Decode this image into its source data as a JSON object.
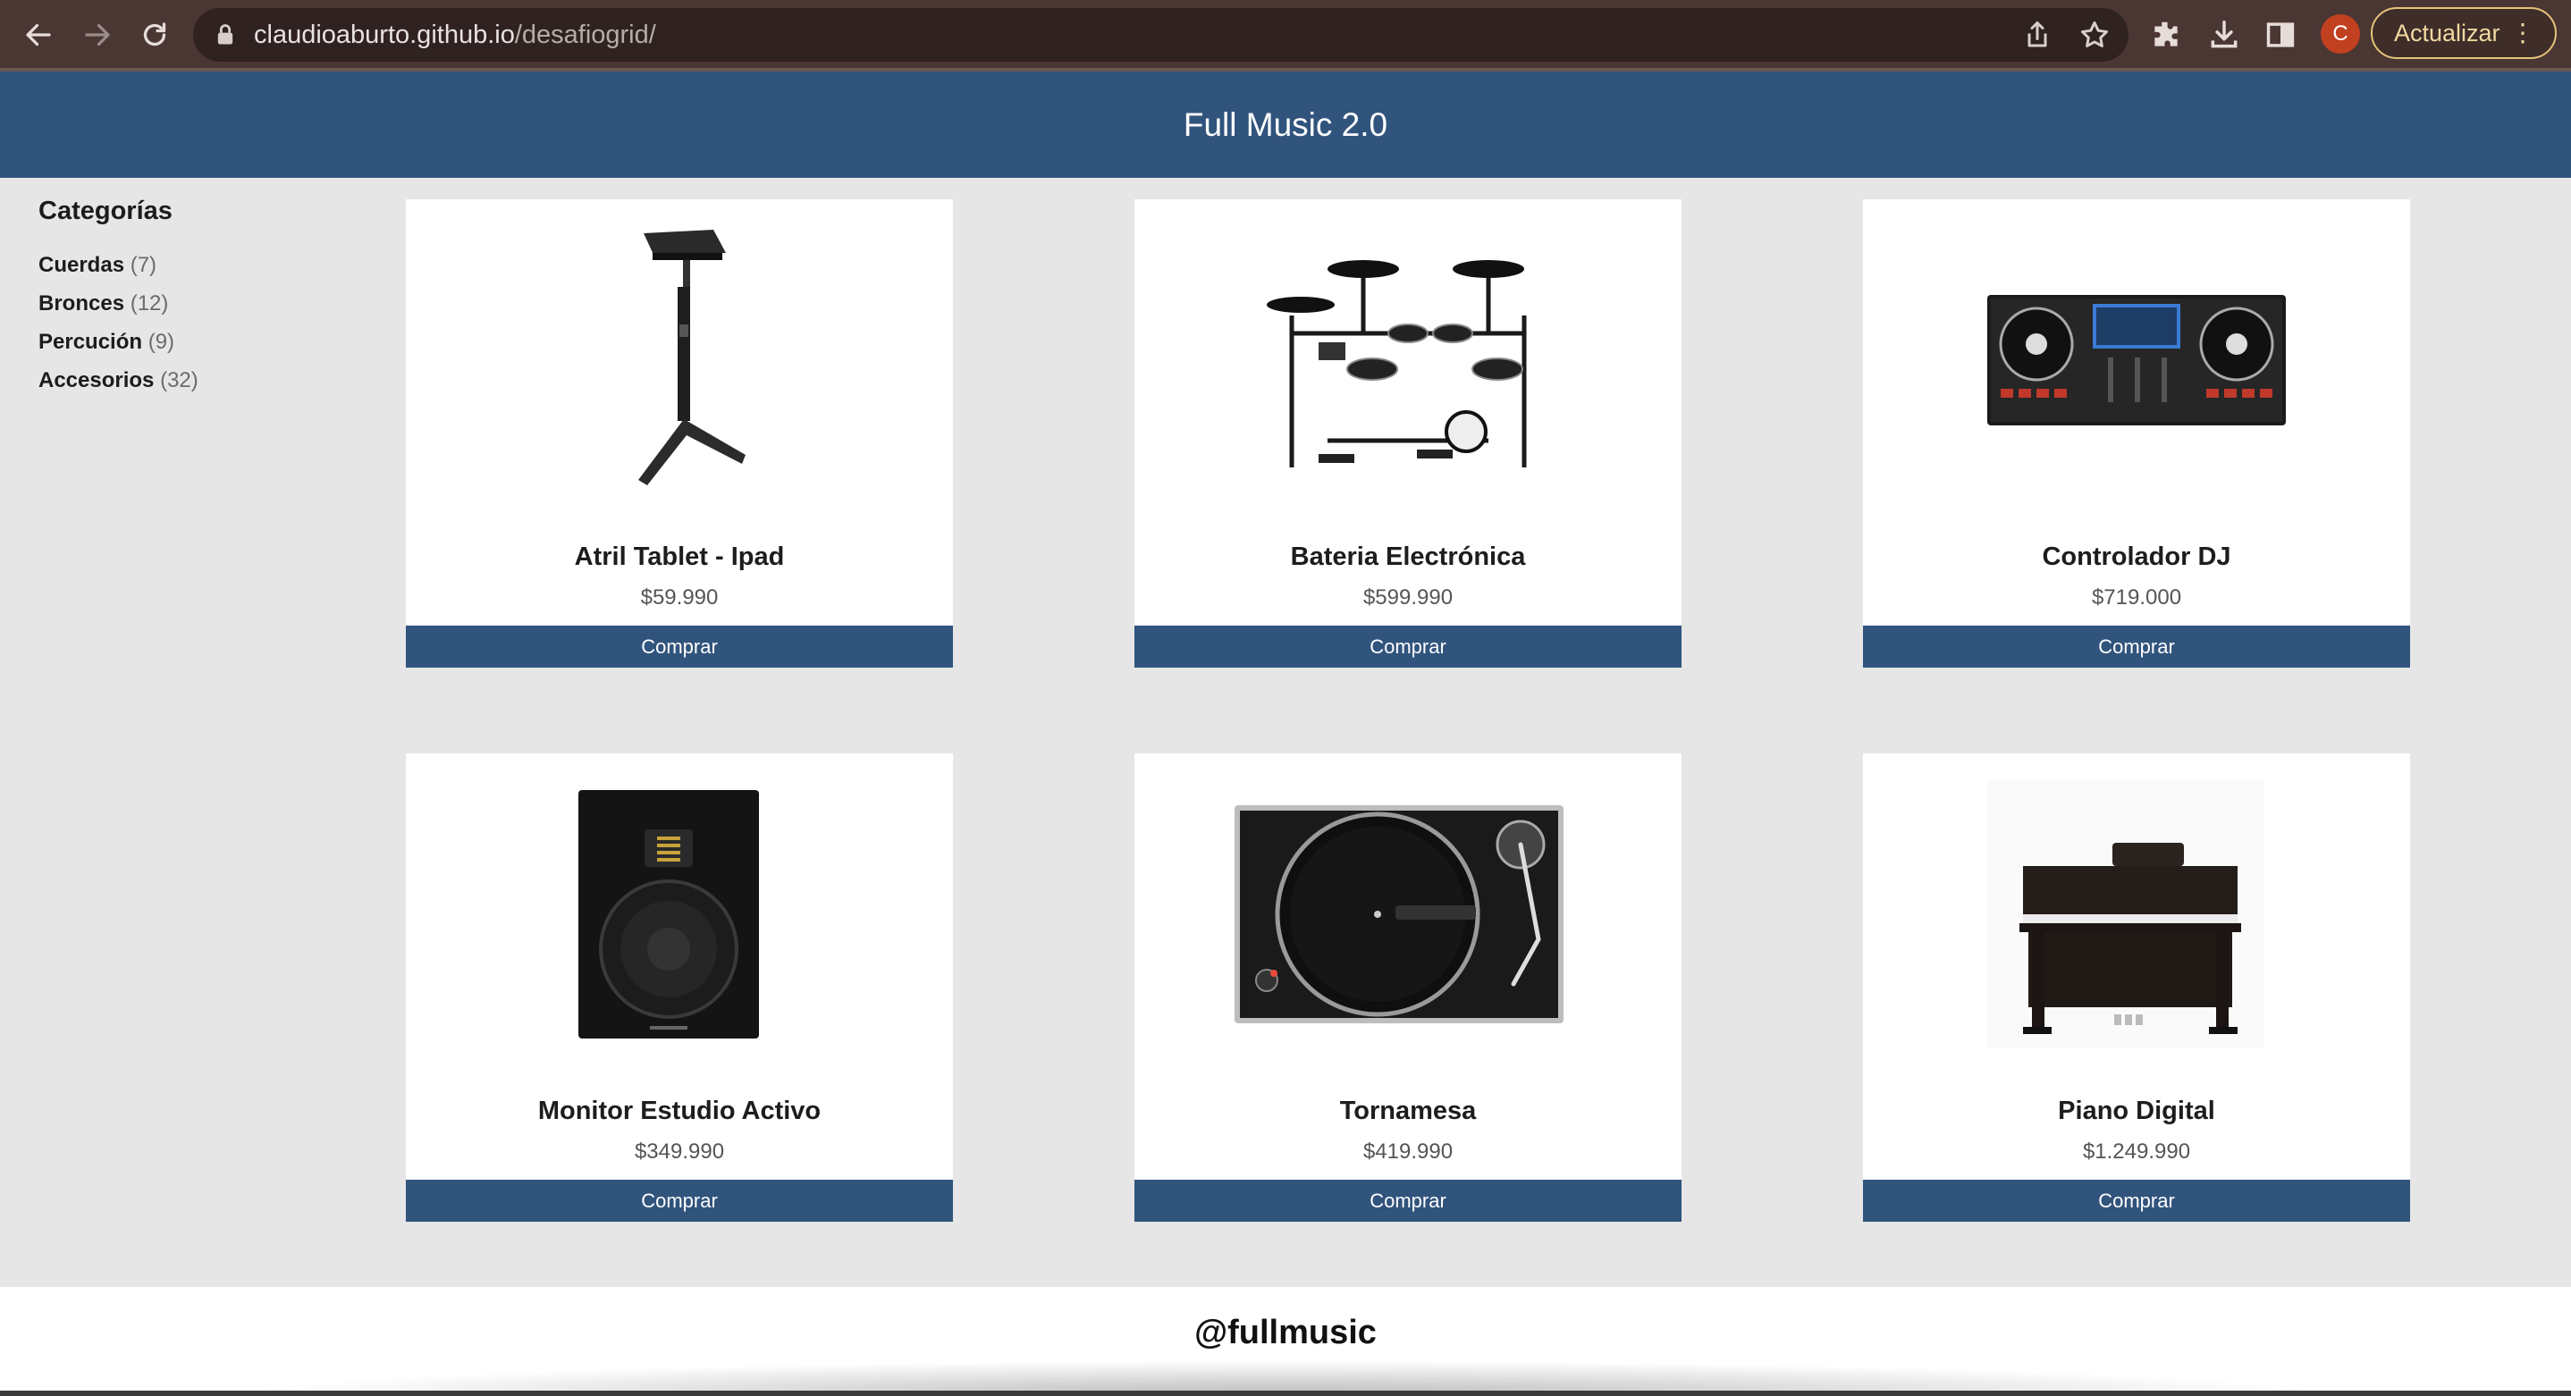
{
  "browser": {
    "url_host": "claudioaburto.github.io",
    "url_path": "/desafiogrid/",
    "avatar_letter": "C",
    "update_label": "Actualizar",
    "menu_glyph": "⋮",
    "icons": [
      "back-icon",
      "forward-icon",
      "reload-icon",
      "lock-icon",
      "share-icon",
      "star-icon",
      "extensions-icon",
      "download-icon",
      "sidepanel-icon",
      "kebab-menu-icon"
    ]
  },
  "header": {
    "title": "Full Music 2.0"
  },
  "sidebar": {
    "title": "Categorías",
    "items": [
      {
        "label": "Cuerdas",
        "count": "(7)"
      },
      {
        "label": "Bronces",
        "count": "(12)"
      },
      {
        "label": "Percución",
        "count": "(9)"
      },
      {
        "label": "Accesorios",
        "count": "(32)"
      }
    ]
  },
  "products": [
    {
      "name": "Atril Tablet - Ipad",
      "price": "$59.990",
      "button": "Comprar",
      "image": "tablet-stand-image"
    },
    {
      "name": "Bateria Electrónica",
      "price": "$599.990",
      "button": "Comprar",
      "image": "electronic-drum-kit-image"
    },
    {
      "name": "Controlador DJ",
      "price": "$719.000",
      "button": "Comprar",
      "image": "dj-controller-image"
    },
    {
      "name": "Monitor Estudio Activo",
      "price": "$349.990",
      "button": "Comprar",
      "image": "studio-monitor-image"
    },
    {
      "name": "Tornamesa",
      "price": "$419.990",
      "button": "Comprar",
      "image": "turntable-image"
    },
    {
      "name": "Piano Digital",
      "price": "$1.249.990",
      "button": "Comprar",
      "image": "digital-piano-image"
    }
  ],
  "footer": {
    "text": "@fullmusic"
  },
  "colors": {
    "brand": "#31547d",
    "page_bg": "#e6e6e6",
    "chrome": "#4a3632"
  }
}
